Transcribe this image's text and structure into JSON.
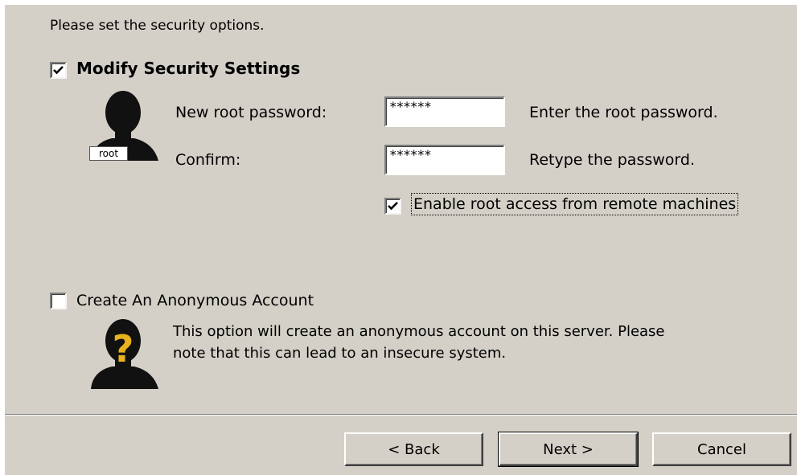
{
  "intro_text": "Please set the security options.",
  "modify_security": {
    "checked": true,
    "label": "Modify Security Settings"
  },
  "root_badge": "root",
  "password": {
    "label": "New root password:",
    "value": "******",
    "hint": "Enter the root password."
  },
  "confirm": {
    "label": "Confirm:",
    "value": "******",
    "hint": "Retype the password."
  },
  "remote_access": {
    "checked": true,
    "label": "Enable root access from remote machines"
  },
  "anonymous": {
    "checked": false,
    "label": "Create An Anonymous Account",
    "desc_line1": "This option will create an anonymous account on this server. Please",
    "desc_line2": "note that this can lead to an insecure system."
  },
  "anonymous_icon_glyph": "?",
  "buttons": {
    "back": "< Back",
    "next": "Next >",
    "cancel": "Cancel"
  },
  "colors": {
    "dialog_bg": "#d4d0c8",
    "question_mark": "#e8b21c",
    "silhouette": "#111111"
  },
  "icons": [
    "checkmark-icon",
    "root-user-icon",
    "anonymous-user-icon"
  ]
}
